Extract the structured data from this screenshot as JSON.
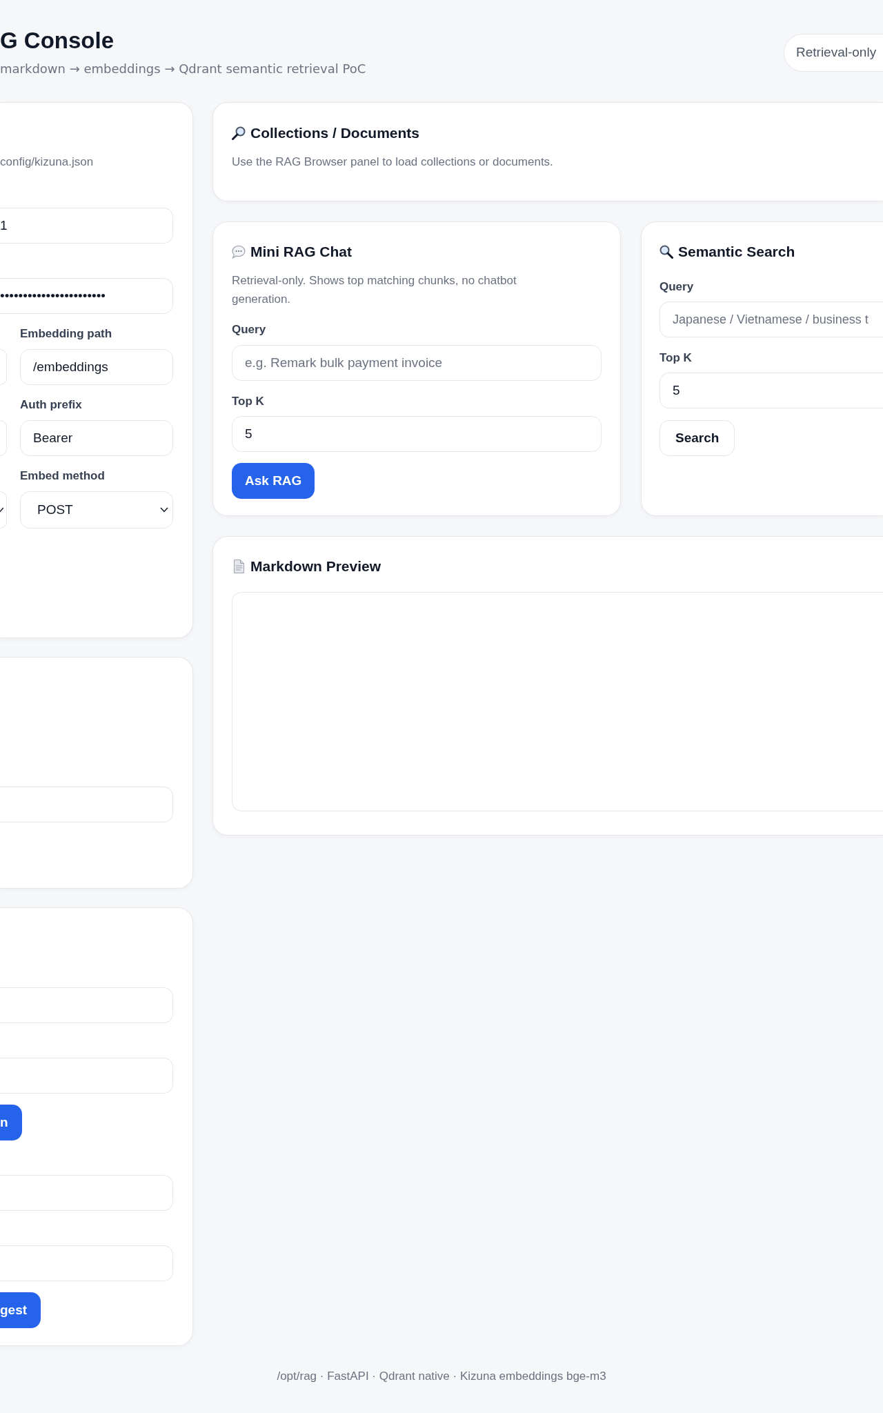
{
  "header": {
    "title": "G Console",
    "subtitle": "markdown → embeddings → Qdrant semantic retrieval PoC",
    "badge": "Retrieval-only"
  },
  "config_panel": {
    "note": "config/kizuna.json",
    "fields": [
      {
        "kind": "text",
        "value": "1"
      },
      {
        "kind": "password",
        "value": "•••••••••••••••••••••••"
      }
    ],
    "paired_fields": [
      {
        "kind": "input",
        "label": "Embedding path",
        "value": "/embeddings"
      },
      {
        "kind": "input",
        "label": "Auth prefix",
        "value": "Bearer"
      },
      {
        "kind": "select",
        "label": "Embed method",
        "value": "POST"
      }
    ]
  },
  "second_panel": {
    "fields": [
      {
        "kind": "input"
      }
    ]
  },
  "third_panel": {
    "items": [
      {
        "kind": "input"
      },
      {
        "kind": "input"
      },
      {
        "kind": "button",
        "label": "n"
      },
      {
        "kind": "input"
      },
      {
        "kind": "input"
      },
      {
        "kind": "button",
        "label": "gest"
      }
    ]
  },
  "collections": {
    "title": "Collections / Documents",
    "description": "Use the RAG Browser panel to load collections or documents."
  },
  "mini_rag_chat": {
    "title": "Mini RAG Chat",
    "description": "Retrieval-only. Shows top matching chunks, no chatbot generation.",
    "query": {
      "label": "Query",
      "placeholder": "e.g. Remark bulk payment invoice"
    },
    "top_k": {
      "label": "Top K",
      "value": "5"
    },
    "button": "Ask RAG"
  },
  "semantic_search": {
    "title": "Semantic Search",
    "query": {
      "label": "Query",
      "placeholder": "Japanese / Vietnamese / business t"
    },
    "top_k": {
      "label": "Top K",
      "value": "5"
    },
    "button": "Search"
  },
  "markdown_preview": {
    "title": "Markdown Preview"
  },
  "footer": "/opt/rag · FastAPI · Qdrant native · Kizuna embeddings bge-m3"
}
